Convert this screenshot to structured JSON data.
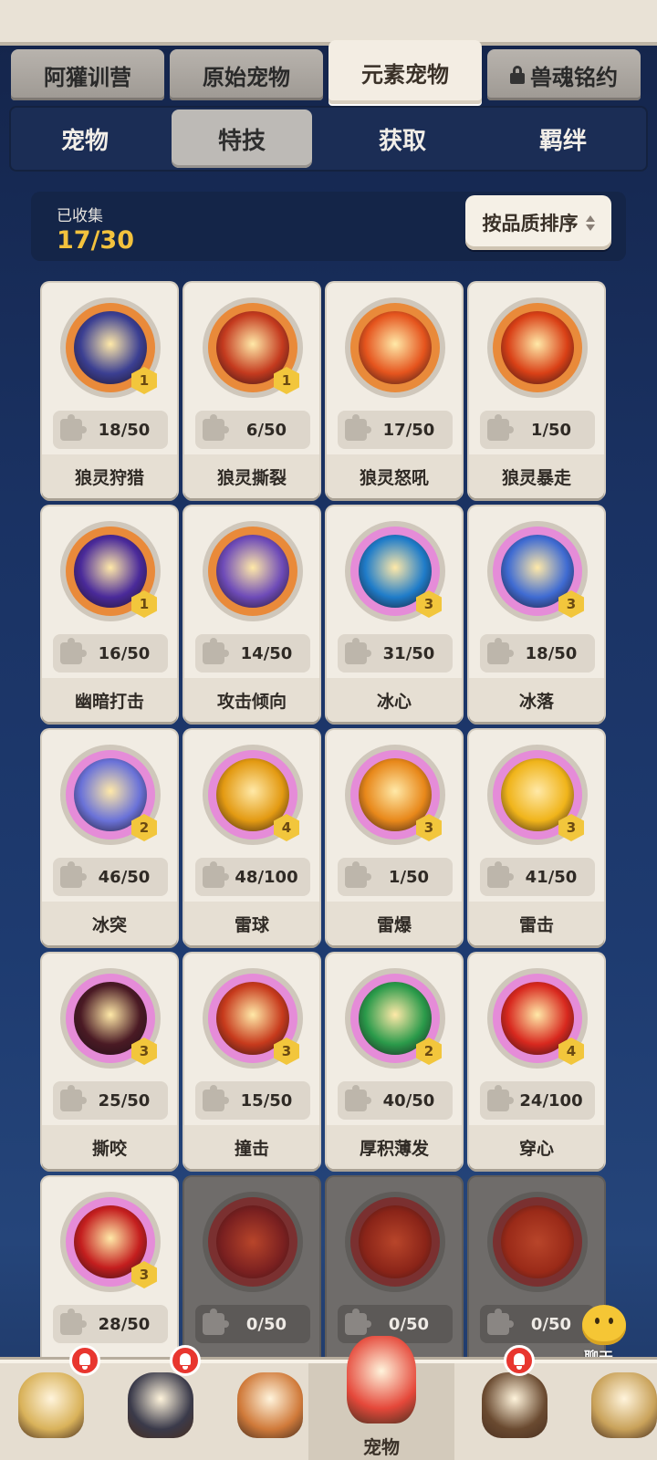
{
  "header_tabs": [
    {
      "label": "阿獾训营",
      "active": false,
      "locked": false
    },
    {
      "label": "原始宠物",
      "active": false,
      "locked": false
    },
    {
      "label": "元素宠物",
      "active": true,
      "locked": false
    },
    {
      "label": "兽魂铭约",
      "active": false,
      "locked": true
    }
  ],
  "sub_tabs": [
    {
      "label": "宠物",
      "active": false
    },
    {
      "label": "特技",
      "active": true
    },
    {
      "label": "获取",
      "active": false
    },
    {
      "label": "羁绊",
      "active": false
    }
  ],
  "collection": {
    "label": "已收集",
    "value": "17/30"
  },
  "sort_button": {
    "label": "按品质排序"
  },
  "skills": [
    {
      "name": "狼灵狩猎",
      "progress": "18/50",
      "level": "1",
      "ring": "#e98a3a",
      "art": "#3b3f92",
      "locked": false
    },
    {
      "name": "狼灵撕裂",
      "progress": "6/50",
      "level": "1",
      "ring": "#e98a3a",
      "art": "#c43a1e",
      "locked": false
    },
    {
      "name": "狼灵怒吼",
      "progress": "17/50",
      "level": "",
      "ring": "#e98a3a",
      "art": "#e5541d",
      "locked": false
    },
    {
      "name": "狼灵暴走",
      "progress": "1/50",
      "level": "",
      "ring": "#e98a3a",
      "art": "#d94016",
      "locked": false
    },
    {
      "name": "幽暗打击",
      "progress": "16/50",
      "level": "1",
      "ring": "#e98a3a",
      "art": "#4a2a9a",
      "locked": false
    },
    {
      "name": "攻击倾向",
      "progress": "14/50",
      "level": "",
      "ring": "#e98a3a",
      "art": "#6e4bb8",
      "locked": false
    },
    {
      "name": "冰心",
      "progress": "31/50",
      "level": "3",
      "ring": "#e58cd8",
      "art": "#1f7cc9",
      "locked": false
    },
    {
      "name": "冰落",
      "progress": "18/50",
      "level": "3",
      "ring": "#e58cd8",
      "art": "#3f6bd2",
      "locked": false
    },
    {
      "name": "冰突",
      "progress": "46/50",
      "level": "2",
      "ring": "#e58cd8",
      "art": "#6a72d8",
      "locked": false
    },
    {
      "name": "雷球",
      "progress": "48/100",
      "level": "4",
      "ring": "#e58cd8",
      "art": "#e39a12",
      "locked": false
    },
    {
      "name": "雷爆",
      "progress": "1/50",
      "level": "3",
      "ring": "#e58cd8",
      "art": "#e8881a",
      "locked": false
    },
    {
      "name": "雷击",
      "progress": "41/50",
      "level": "3",
      "ring": "#e58cd8",
      "art": "#f0b41a",
      "locked": false
    },
    {
      "name": "撕咬",
      "progress": "25/50",
      "level": "3",
      "ring": "#e58cd8",
      "art": "#4a1a24",
      "locked": false
    },
    {
      "name": "撞击",
      "progress": "15/50",
      "level": "3",
      "ring": "#e58cd8",
      "art": "#c73a1c",
      "locked": false
    },
    {
      "name": "厚积薄发",
      "progress": "40/50",
      "level": "2",
      "ring": "#e58cd8",
      "art": "#2a9a4a",
      "locked": false
    },
    {
      "name": "穿心",
      "progress": "24/100",
      "level": "4",
      "ring": "#e58cd8",
      "art": "#d8281e",
      "locked": false
    },
    {
      "name": "",
      "progress": "28/50",
      "level": "3",
      "ring": "#e58cd8",
      "art": "#c41e1e",
      "locked": false
    },
    {
      "name": "",
      "progress": "0/50",
      "level": "",
      "ring": "#7a3030",
      "art": "#7a2020",
      "locked": true
    },
    {
      "name": "",
      "progress": "0/50",
      "level": "",
      "ring": "#7a3030",
      "art": "#8a2418",
      "locked": true
    },
    {
      "name": "",
      "progress": "0/50",
      "level": "",
      "ring": "#7a3030",
      "art": "#9a2a18",
      "locked": true
    }
  ],
  "chat": {
    "label": "聊天"
  },
  "bottom_nav": [
    {
      "label": "",
      "active": false,
      "notify": true,
      "color": "#d9b25a"
    },
    {
      "label": "",
      "active": false,
      "notify": true,
      "color": "#3a3a4a"
    },
    {
      "label": "",
      "active": false,
      "notify": false,
      "color": "#d07a3a"
    },
    {
      "label": "宠物",
      "active": true,
      "notify": false,
      "color": "#e5483a"
    },
    {
      "label": "",
      "active": false,
      "notify": true,
      "color": "#6a4a30"
    },
    {
      "label": "",
      "active": false,
      "notify": false,
      "color": "#c9a25a"
    }
  ]
}
